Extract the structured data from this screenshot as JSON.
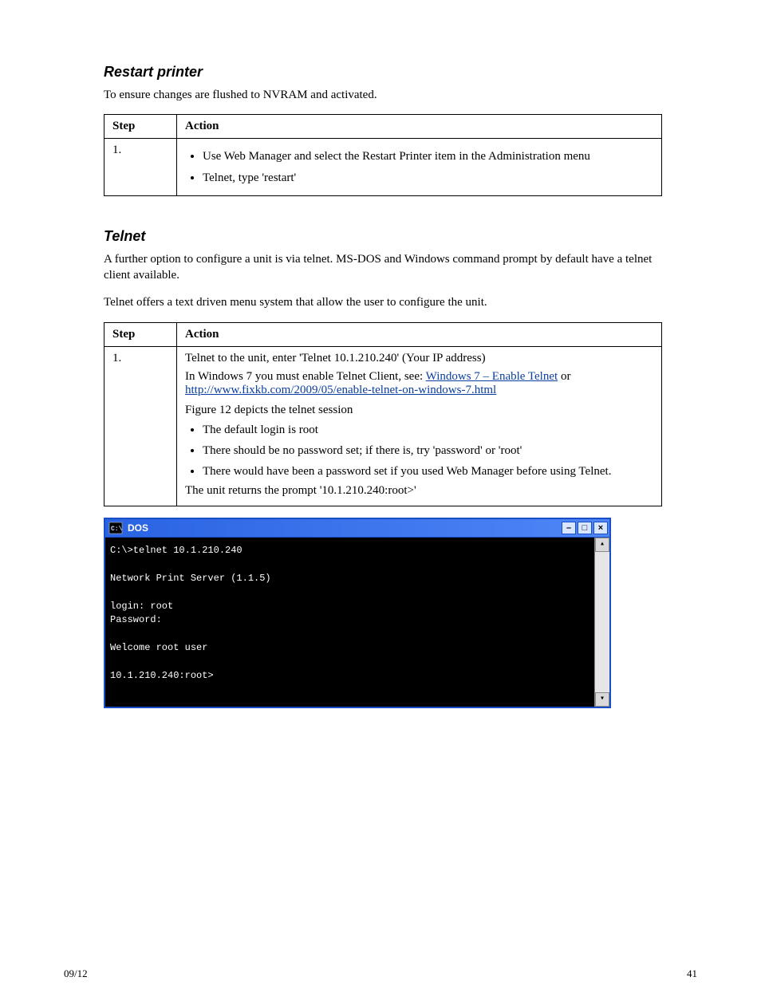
{
  "heading_restart": "Restart printer",
  "restart_intro": "To ensure changes are flushed to NVRAM and activated.",
  "table1": {
    "header_step": "Step",
    "header_action": "Action",
    "row1_step": "1.",
    "row1_b1": "Use Web Manager and select the Restart Printer item in the Administration menu",
    "row1_b2": "Telnet, type 'restart'"
  },
  "heading_telnet": "Telnet",
  "telnet_body1": "A further option to configure a unit is via telnet. MS-DOS and Windows command prompt by default have a telnet client available.",
  "telnet_body2": "Telnet offers a text driven menu system that allow the user to configure the unit.",
  "table2": {
    "header_step": "Step",
    "header_action": "Action",
    "row1_step": "1.",
    "row1_line1": "Telnet to the unit, enter 'Telnet 10.1.210.240' (Your IP address)",
    "row1_line2_pre": "In Windows 7 you must enable Telnet Client, see: ",
    "row1_link_text": "Windows 7 – Enable Telnet",
    "row1_or": " or ",
    "row1_link2_text": "http://www.fixkb.com/2009/05/enable-telnet-on-windows-7.html",
    "row1_line3": "Figure 12 depicts the telnet session",
    "row1_b1": "The default login is root",
    "row1_b2": "There should be no password set; if there is, try 'password' or 'root'",
    "row1_b3": "There would have been a password set if you used Web Manager before using Telnet.",
    "row1_line4": "The unit returns the prompt '10.1.210.240:root>'"
  },
  "dos": {
    "title": "DOS",
    "min": "–",
    "max": "□",
    "close": "×",
    "scroll_up": "▴",
    "scroll_down": "▾",
    "line1": "C:\\>telnet 10.1.210.240",
    "line2": "Network Print Server (1.1.5)",
    "line3": "login: root",
    "line4": "Password:",
    "line5": "Welcome root user",
    "line6": "10.1.210.240:root>"
  },
  "footer_left": "09/12",
  "footer_right": "41"
}
